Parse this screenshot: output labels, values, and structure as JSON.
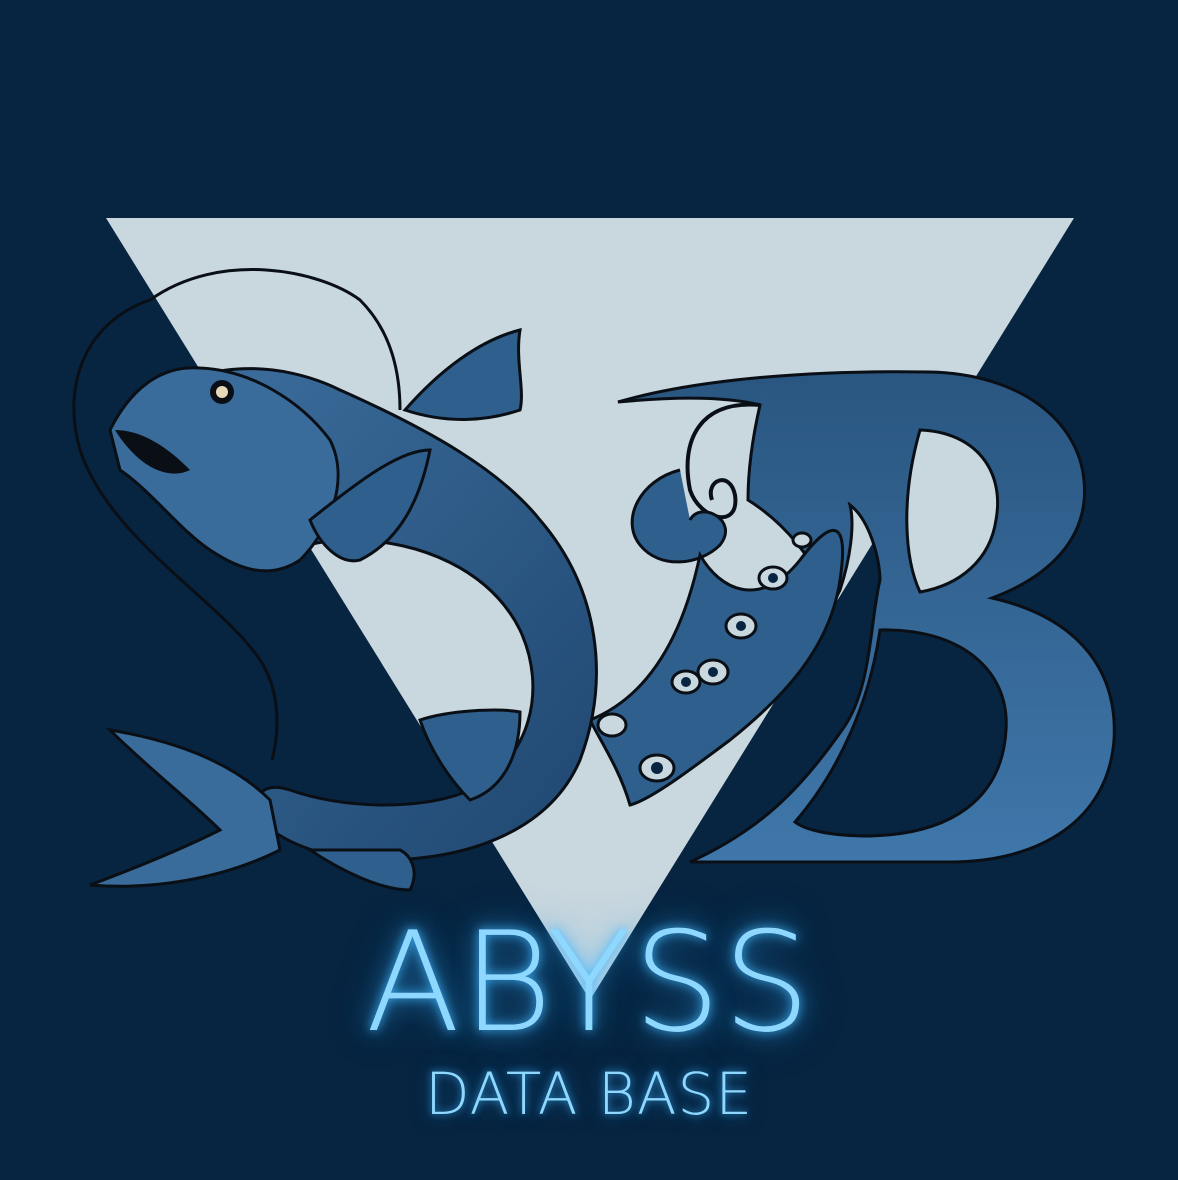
{
  "brand": {
    "title": "ABYSS",
    "subtitle": "DATA BASE",
    "logo_letters": "SB"
  },
  "colors": {
    "background": "#072440",
    "triangle": "#c9d7de",
    "creature_blue": "#2f5f8c",
    "creature_dark": "#1f4670",
    "outline": "#0a0f16",
    "glow_text": "#8ed7ff"
  },
  "logo": {
    "elements": [
      "triangle-emblem",
      "dragonfish-s",
      "letter-b",
      "tentacle-with-suckers"
    ]
  }
}
